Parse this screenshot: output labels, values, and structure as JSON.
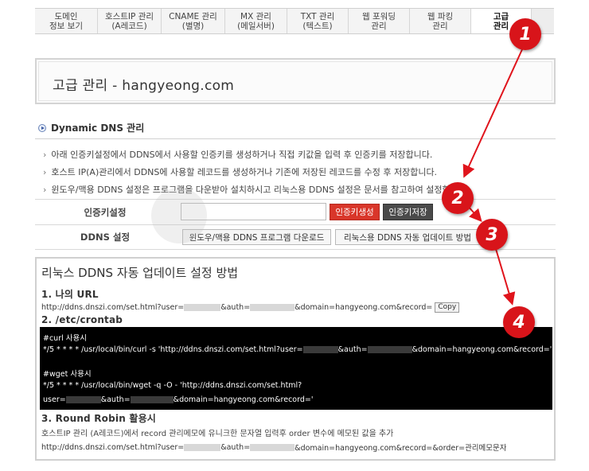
{
  "tabs": [
    {
      "label": "도메인\n정보 보기"
    },
    {
      "label": "호스트IP 관리\n(A레코드)"
    },
    {
      "label": "CNAME 관리\n(별명)"
    },
    {
      "label": "MX 관리\n(메일서버)"
    },
    {
      "label": "TXT 관리\n(텍스트)"
    },
    {
      "label": "웹 포워딩\n관리"
    },
    {
      "label": "웹 파킹\n관리"
    },
    {
      "label": "고급\n관리"
    }
  ],
  "page_title": "고급 관리 - hangyeong.com",
  "section_title": "Dynamic DNS 관리",
  "info_lines": [
    "아래 인증키설정에서 DDNS에서 사용할 인증키를 생성하거나 직접 키값을 입력 후 인증키를 저장합니다.",
    "호스트 IP(A)관리에서 DDNS에 사용할 레코드를 생성하거나 기존에 저장된 레코드를 수정 후 저장합니다.",
    "윈도우/맥용 DDNS 설정은 프로그램을 다운받아 설치하시고 리눅스용 DDNS 설정은 문서를 참고하여 설정합니다."
  ],
  "form": {
    "key_label": "인증키설정",
    "gen_button": "인증키생성",
    "save_button": "인증키저장",
    "ddns_label": "DDNS 설정",
    "download_button": "윈도우/맥용 DDNS 프로그램 다운로드",
    "linux_button": "리눅스용 DDNS 자동 업데이트 방법"
  },
  "guide": {
    "title": "리눅스 DDNS 자동 업데이트 설정 방법",
    "step1": "1. 나의 URL",
    "url1_a": "http://ddns.dnszi.com/set.html?user=",
    "url1_b": "&auth=",
    "url1_c": "&domain=hangyeong.com&record=",
    "copy": "Copy",
    "step2": "2. /etc/crontab",
    "curl_title": "#curl 사용시",
    "curl_a": "*/5 * * * * /usr/local/bin/curl -s 'http://ddns.dnszi.com/set.html?user=",
    "curl_b": "&auth=",
    "curl_c": "&domain=hangyeong.com&record='",
    "wget_title": "#wget 사용시",
    "wget_line1": "*/5 * * * * /usr/local/bin/wget -q -O - 'http://ddns.dnszi.com/set.html?",
    "wget_a": "user=",
    "wget_b": "&auth=",
    "wget_c": "&domain=hangyeong.com&record='",
    "step3": "3. Round Robin 활용시",
    "rr_note": "호스트IP 관리 (A레코드)에서 record 관리메모에 유니크한 문자열 입력후 order 변수에 메모된 값을 추가",
    "rr_a": "http://ddns.dnszi.com/set.html?user=",
    "rr_b": "&auth=",
    "rr_c": "&domain=hangyeong.com&record=&order=관리메모문자"
  },
  "annotations": [
    "1",
    "2",
    "3",
    "4"
  ],
  "colors": {
    "badge": "#d8141a",
    "gen_button": "#d9362a",
    "save_button": "#4a4a4a"
  }
}
